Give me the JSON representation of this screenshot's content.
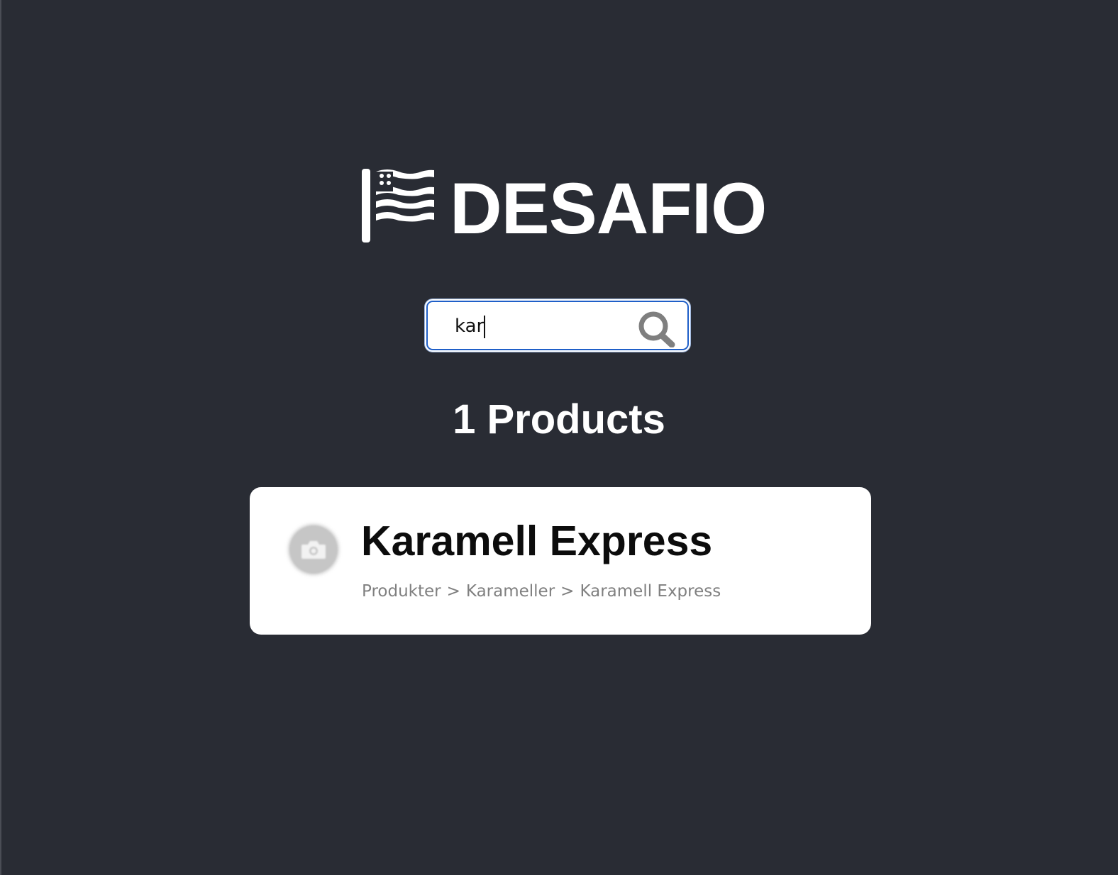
{
  "brand": {
    "name": "DESAFIO",
    "logo_icon": "flag-icon"
  },
  "search": {
    "value": "kar",
    "icon": "search-icon"
  },
  "results": {
    "count_label": "1 Products"
  },
  "products": [
    {
      "title": "Karamell Express",
      "thumbnail_icon": "camera-icon",
      "breadcrumb": [
        "Produkter",
        "Karameller",
        "Karamell Express"
      ],
      "separator": ">"
    }
  ],
  "colors": {
    "background": "#292c34",
    "card": "#ffffff",
    "focus_ring": "#1f5fc8",
    "muted_text": "#808080"
  }
}
